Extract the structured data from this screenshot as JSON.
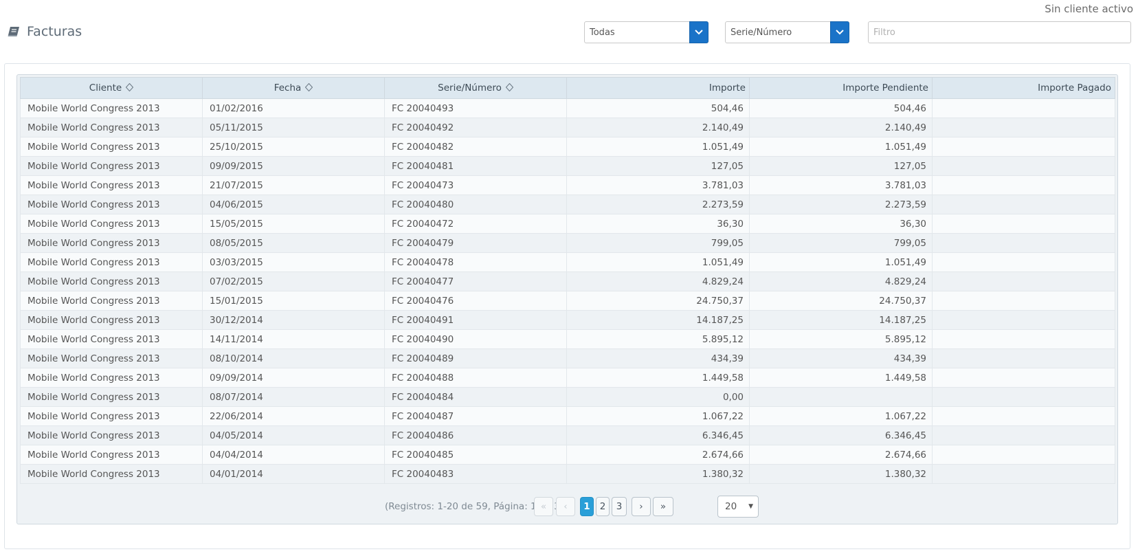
{
  "header": {
    "status": "Sin cliente activo",
    "title": "Facturas",
    "icon": "book-icon"
  },
  "filters": {
    "status_select": "Todas",
    "field_select": "Serie/Número",
    "filter_placeholder": "Filtro"
  },
  "table": {
    "columns": [
      "Cliente",
      "Fecha",
      "Serie/Número",
      "Importe",
      "Importe Pendiente",
      "Importe Pagado"
    ],
    "rows": [
      [
        "Mobile World Congress 2013",
        "01/02/2016",
        "FC 20040493",
        "504,46",
        "504,46",
        ""
      ],
      [
        "Mobile World Congress 2013",
        "05/11/2015",
        "FC 20040492",
        "2.140,49",
        "2.140,49",
        ""
      ],
      [
        "Mobile World Congress 2013",
        "25/10/2015",
        "FC 20040482",
        "1.051,49",
        "1.051,49",
        ""
      ],
      [
        "Mobile World Congress 2013",
        "09/09/2015",
        "FC 20040481",
        "127,05",
        "127,05",
        ""
      ],
      [
        "Mobile World Congress 2013",
        "21/07/2015",
        "FC 20040473",
        "3.781,03",
        "3.781,03",
        ""
      ],
      [
        "Mobile World Congress 2013",
        "04/06/2015",
        "FC 20040480",
        "2.273,59",
        "2.273,59",
        ""
      ],
      [
        "Mobile World Congress 2013",
        "15/05/2015",
        "FC 20040472",
        "36,30",
        "36,30",
        ""
      ],
      [
        "Mobile World Congress 2013",
        "08/05/2015",
        "FC 20040479",
        "799,05",
        "799,05",
        ""
      ],
      [
        "Mobile World Congress 2013",
        "03/03/2015",
        "FC 20040478",
        "1.051,49",
        "1.051,49",
        ""
      ],
      [
        "Mobile World Congress 2013",
        "07/02/2015",
        "FC 20040477",
        "4.829,24",
        "4.829,24",
        ""
      ],
      [
        "Mobile World Congress 2013",
        "15/01/2015",
        "FC 20040476",
        "24.750,37",
        "24.750,37",
        ""
      ],
      [
        "Mobile World Congress 2013",
        "30/12/2014",
        "FC 20040491",
        "14.187,25",
        "14.187,25",
        ""
      ],
      [
        "Mobile World Congress 2013",
        "14/11/2014",
        "FC 20040490",
        "5.895,12",
        "5.895,12",
        ""
      ],
      [
        "Mobile World Congress 2013",
        "08/10/2014",
        "FC 20040489",
        "434,39",
        "434,39",
        ""
      ],
      [
        "Mobile World Congress 2013",
        "09/09/2014",
        "FC 20040488",
        "1.449,58",
        "1.449,58",
        ""
      ],
      [
        "Mobile World Congress 2013",
        "08/07/2014",
        "FC 20040484",
        "0,00",
        "",
        ""
      ],
      [
        "Mobile World Congress 2013",
        "22/06/2014",
        "FC 20040487",
        "1.067,22",
        "1.067,22",
        ""
      ],
      [
        "Mobile World Congress 2013",
        "04/05/2014",
        "FC 20040486",
        "6.346,45",
        "6.346,45",
        ""
      ],
      [
        "Mobile World Congress 2013",
        "04/04/2014",
        "FC 20040485",
        "2.674,66",
        "2.674,66",
        ""
      ],
      [
        "Mobile World Congress 2013",
        "04/01/2014",
        "FC 20040483",
        "1.380,32",
        "1.380,32",
        ""
      ]
    ]
  },
  "pager": {
    "info": "(Registros: 1-20 de 59, Página: 1 de 3)",
    "first": "«",
    "prev": "‹",
    "pages": [
      "1",
      "2",
      "3"
    ],
    "next": "›",
    "last": "»",
    "page_size": "20"
  },
  "colors": {
    "accent": "#1a73c8",
    "active_page": "#2a9fd8",
    "header_bg": "#dde8f0"
  }
}
